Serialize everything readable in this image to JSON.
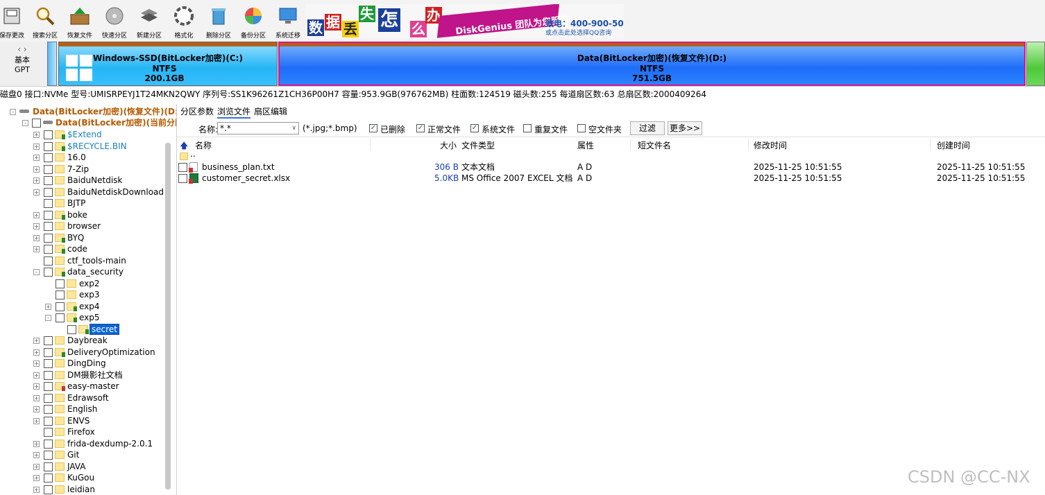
{
  "toolbar": {
    "tools": [
      {
        "label": "保存更改",
        "icon": "save-icon"
      },
      {
        "label": "搜索分区",
        "icon": "magnifier-icon"
      },
      {
        "label": "恢复文件",
        "icon": "recover-icon"
      },
      {
        "label": "快速分区",
        "icon": "quick-partition-icon"
      },
      {
        "label": "新建分区",
        "icon": "new-partition-icon"
      },
      {
        "label": "格式化",
        "icon": "format-icon"
      },
      {
        "label": "删除分区",
        "icon": "trash-icon"
      },
      {
        "label": "备份分区",
        "icon": "backup-icon"
      },
      {
        "label": "系统迁移",
        "icon": "migrate-icon"
      }
    ],
    "ad": {
      "chars": [
        "数",
        "据",
        "丢",
        "失",
        "怎",
        "么",
        "办"
      ],
      "brand": "DiskGenius 团队为您服务",
      "phone": "致电：400-900-5080",
      "qq": "或点击此处选择QQ咨询"
    }
  },
  "diskbar": {
    "nav_type": "基本",
    "nav_table": "GPT",
    "partitions": [
      {
        "name": "Windows-SSD(BitLocker加密)(C:)",
        "fs": "NTFS",
        "size": "200.1GB"
      },
      {
        "name": "Data(BitLocker加密)(恢复文件)(D:)",
        "fs": "NTFS",
        "size": "751.5GB"
      }
    ]
  },
  "disk_info": "磁盘0 接口:NVMe  型号:UMISRPEYJ1T24MKN2QWY  序列号:SS1K96261Z1CH36P00H7  容量:953.9GB(976762MB)  柱面数:124519  磁头数:255  每道扇区数:63  总扇区数:2000409264",
  "tree": {
    "root": "Data(BitLocker加密)(恢复文件)(D:)",
    "current": "Data(BitLocker加密)(当前分区)",
    "items": [
      {
        "name": "$Extend",
        "level": 2,
        "pm": "+",
        "mark": "g",
        "sys": true
      },
      {
        "name": "$RECYCLE.BIN",
        "level": 2,
        "pm": "+",
        "mark": "g",
        "sys": true
      },
      {
        "name": "16.0",
        "level": 2,
        "pm": "+",
        "mark": ""
      },
      {
        "name": "7-Zip",
        "level": 2,
        "pm": "+",
        "mark": ""
      },
      {
        "name": "BaiduNetdisk",
        "level": 2,
        "pm": "+",
        "mark": ""
      },
      {
        "name": "BaiduNetdiskDownload",
        "level": 2,
        "pm": "+",
        "mark": ""
      },
      {
        "name": "BJTP",
        "level": 2,
        "pm": "",
        "mark": ""
      },
      {
        "name": "boke",
        "level": 2,
        "pm": "+",
        "mark": "g"
      },
      {
        "name": "browser",
        "level": 2,
        "pm": "+",
        "mark": ""
      },
      {
        "name": "BYQ",
        "level": 2,
        "pm": "+",
        "mark": "g"
      },
      {
        "name": "code",
        "level": 2,
        "pm": "+",
        "mark": "g"
      },
      {
        "name": "ctf_tools-main",
        "level": 2,
        "pm": "",
        "mark": ""
      },
      {
        "name": "data_security",
        "level": 2,
        "pm": "-",
        "mark": "g"
      },
      {
        "name": "exp2",
        "level": 3,
        "pm": "",
        "mark": ""
      },
      {
        "name": "exp3",
        "level": 3,
        "pm": "",
        "mark": ""
      },
      {
        "name": "exp4",
        "level": 3,
        "pm": "+",
        "mark": "g"
      },
      {
        "name": "exp5",
        "level": 3,
        "pm": "-",
        "mark": "g"
      },
      {
        "name": "secret",
        "level": 4,
        "pm": "",
        "mark": "g",
        "selected": true
      },
      {
        "name": "Daybreak",
        "level": 2,
        "pm": "+",
        "mark": ""
      },
      {
        "name": "DeliveryOptimization",
        "level": 2,
        "pm": "+",
        "mark": "g"
      },
      {
        "name": "DingDing",
        "level": 2,
        "pm": "+",
        "mark": ""
      },
      {
        "name": "DM摄影社文档",
        "level": 2,
        "pm": "+",
        "mark": ""
      },
      {
        "name": "easy-master",
        "level": 2,
        "pm": "+",
        "mark": "r"
      },
      {
        "name": "Edrawsoft",
        "level": 2,
        "pm": "+",
        "mark": ""
      },
      {
        "name": "English",
        "level": 2,
        "pm": "+",
        "mark": ""
      },
      {
        "name": "ENVS",
        "level": 2,
        "pm": "+",
        "mark": ""
      },
      {
        "name": "Firefox",
        "level": 2,
        "pm": "",
        "mark": ""
      },
      {
        "name": "frida-dexdump-2.0.1",
        "level": 2,
        "pm": "+",
        "mark": ""
      },
      {
        "name": "Git",
        "level": 2,
        "pm": "+",
        "mark": ""
      },
      {
        "name": "JAVA",
        "level": 2,
        "pm": "+",
        "mark": ""
      },
      {
        "name": "KuGou",
        "level": 2,
        "pm": "+",
        "mark": ""
      },
      {
        "name": "leidian",
        "level": 2,
        "pm": "+",
        "mark": ""
      }
    ]
  },
  "tabs": [
    "分区参数",
    "浏览文件",
    "扇区编辑"
  ],
  "filter": {
    "name_label": "名称:",
    "name_value": "*.*",
    "hint": "(*.jpg;*.bmp)",
    "checks": [
      {
        "label": "已删除",
        "checked": true
      },
      {
        "label": "正常文件",
        "checked": true
      },
      {
        "label": "系统文件",
        "checked": true
      },
      {
        "label": "重复文件",
        "checked": false
      },
      {
        "label": "空文件夹",
        "checked": false
      }
    ],
    "filter_btn": "过滤",
    "more_btn": "更多>>"
  },
  "columns": [
    "名称",
    "大小",
    "文件类型",
    "属性",
    "短文件名",
    "修改时间",
    "创建时间"
  ],
  "parent_dir": "..",
  "files": [
    {
      "name": "business_plan.txt",
      "size": "306 B",
      "type": "文本文档",
      "attr": "A D",
      "short": "",
      "mtime": "2025-11-25 10:51:55",
      "ctime": "2025-11-25 10:51:55"
    },
    {
      "name": "customer_secret.xlsx",
      "size": "5.0KB",
      "type": "MS Office 2007 EXCEL 文档",
      "attr": "A D",
      "short": "",
      "mtime": "2025-11-25 10:51:55",
      "ctime": "2025-11-25 10:51:55"
    }
  ],
  "watermark": "CSDN @CC-NX",
  "colors": {
    "accent": "#c0148a",
    "partition_c": "#25b5f5",
    "partition_d": "#1e6cf8",
    "tree_root": "#b45a00",
    "file_size": "#1b3fb0",
    "selected": "#0a64d8"
  }
}
